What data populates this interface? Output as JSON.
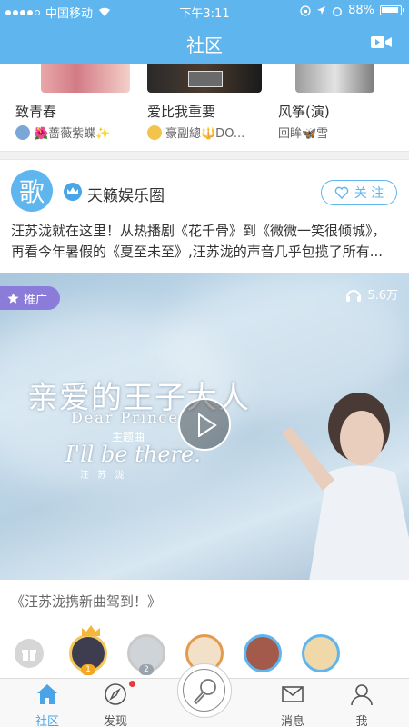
{
  "status_bar": {
    "carrier": "中国移动",
    "time": "下午3:11",
    "battery": "88%"
  },
  "header": {
    "title": "社区"
  },
  "top_cards": [
    {
      "title": "致青春",
      "subtitle": "🌺蔷薇紫蝶✨"
    },
    {
      "title": "爱比我重要",
      "subtitle": "豪副總🔱DO..."
    },
    {
      "title": "风筝(演)",
      "subtitle": "回眸🦋雪"
    }
  ],
  "post": {
    "circle_logo_char": "歌",
    "circle_name": "天籁娱乐圈",
    "follow_label": "关 注",
    "text_line1": "汪苏泷就在这里！从热播剧《花千骨》到《微微一笑很倾城》，",
    "text_line2": "再看今年暑假的《夏至未至》,汪苏泷的声音几乎包揽了所有...",
    "promo_label": "推广",
    "listen_count": "5.6万",
    "video_title_cn": "亲爱的王子大人",
    "video_title_en": "Dear Prince",
    "video_theme_label": "主题曲",
    "video_song": "I'll be there.",
    "video_artist": "汪 苏 泷",
    "caption": "《汪苏泷携新曲驾到！》"
  },
  "ranks": [
    "1",
    "2",
    "3"
  ],
  "tabs": [
    {
      "label": "社区"
    },
    {
      "label": "发现"
    },
    {
      "label": "消息"
    },
    {
      "label": "我"
    }
  ],
  "colors": {
    "primary": "#5fb6ef",
    "promo": "#8a7cd8"
  }
}
